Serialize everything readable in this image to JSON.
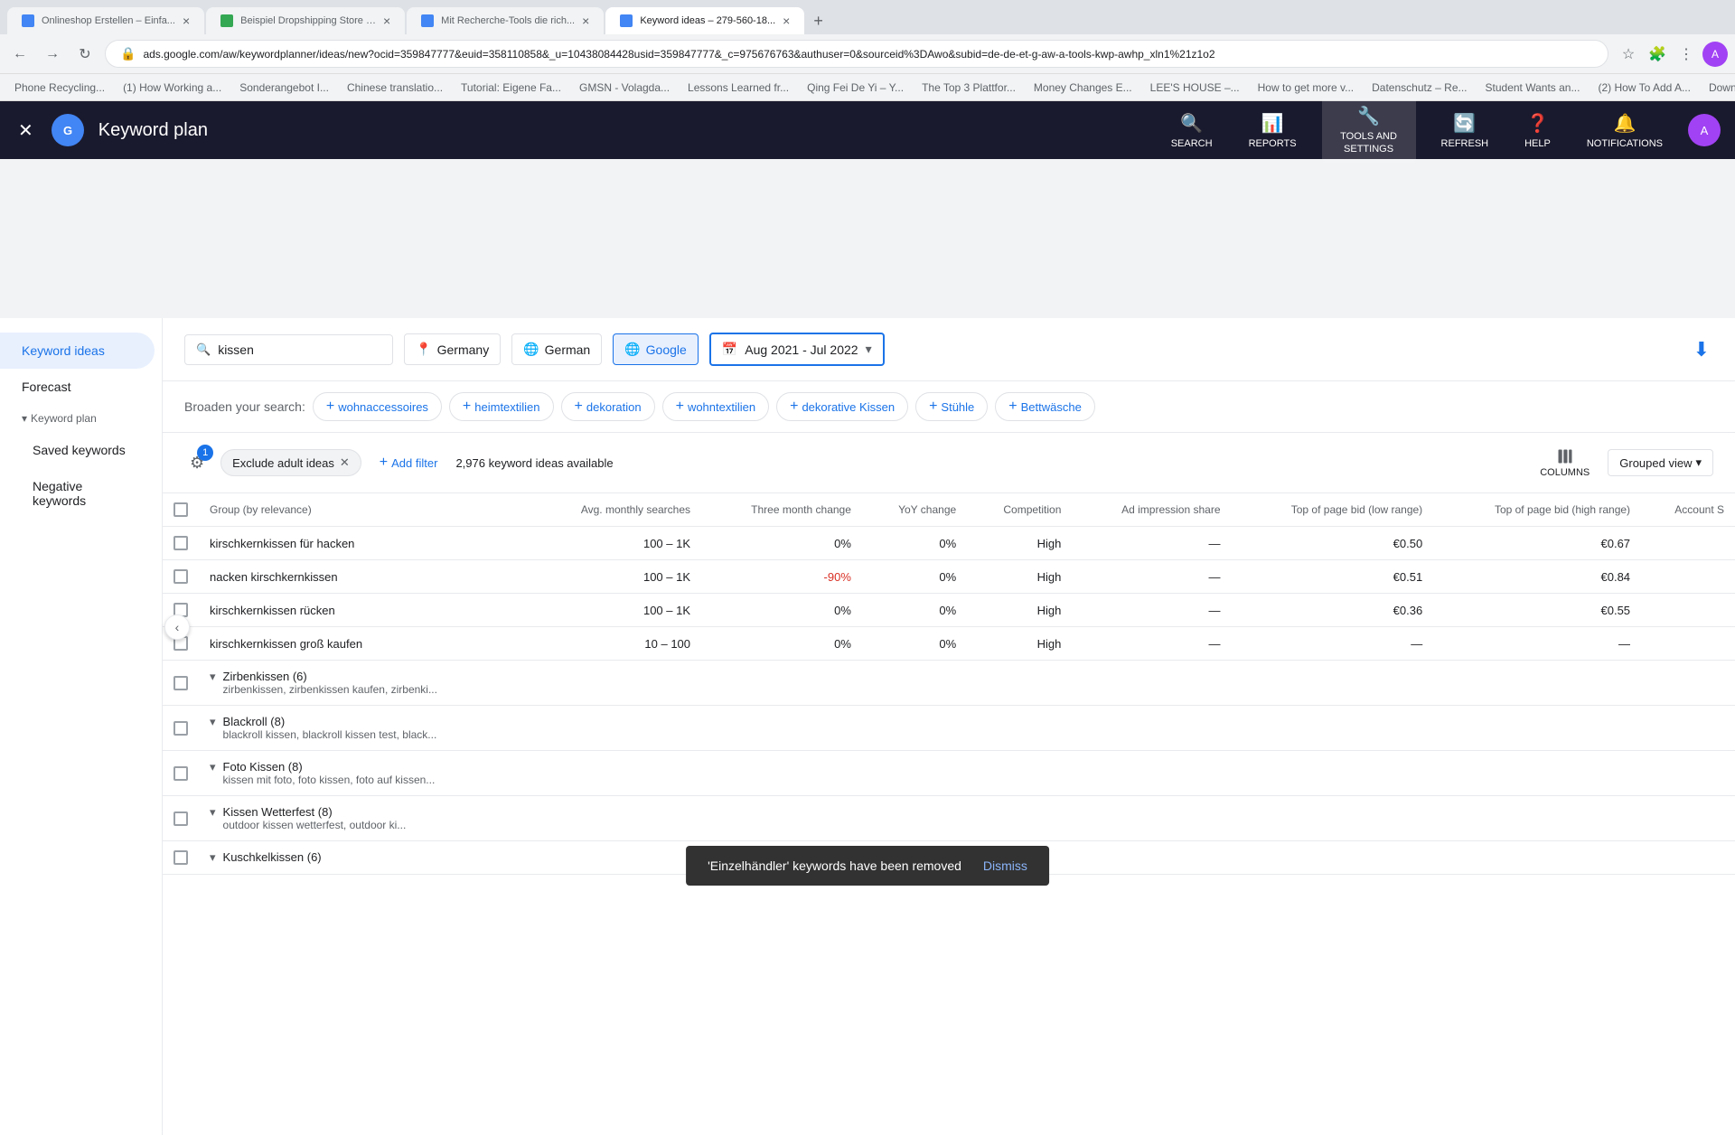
{
  "browser": {
    "tabs": [
      {
        "id": 1,
        "title": "Onlineshop Erstellen – Einfa...",
        "active": false,
        "favicon_color": "#4285f4"
      },
      {
        "id": 2,
        "title": "Beispiel Dropshipping Store –...",
        "active": false,
        "favicon_color": "#34a853"
      },
      {
        "id": 3,
        "title": "Mit Recherche-Tools die rich...",
        "active": false,
        "favicon_color": "#4285f4"
      },
      {
        "id": 4,
        "title": "Keyword ideas – 279-560-18...",
        "active": true,
        "favicon_color": "#4285f4"
      }
    ],
    "url": "ads.google.com/aw/keywordplanner/ideas/new?ocid=359847777&euid=358110858&_u=10438084428usid=359847777&_c=975676763&authuser=0&sourceid%3DAwo&subid=de-de-et-g-aw-a-tools-kwp-awhp_xln1%21z1o2",
    "bookmarks": [
      "Phone Recycling...",
      "(1) How Working a...",
      "Sonderangebot I...",
      "Chinese translatio...",
      "Tutorial: Eigene Fa...",
      "GMSN - Volagda...",
      "Lessons Learned fr...",
      "Qing Fei De Yi – Y...",
      "The Top 3 Plattfor...",
      "Money Changes E...",
      "LEE'S HOUSE –...",
      "How to get more v...",
      "Datenschutz – Re...",
      "Student Wants an...",
      "(2) How To Add A...",
      "Download – Cooki..."
    ]
  },
  "app": {
    "title": "Keyword plan",
    "nav": {
      "search_label": "SEARCH",
      "reports_label": "REPORTS",
      "tools_label": "TOOLS AND SETTINGS",
      "refresh_label": "REFRESH",
      "help_label": "HELP",
      "notifications_label": "NOTIFICATIONS"
    },
    "sidebar": {
      "items": [
        {
          "id": "keyword-ideas",
          "label": "Keyword ideas",
          "active": true
        },
        {
          "id": "forecast",
          "label": "Forecast",
          "active": false
        },
        {
          "id": "keyword-plan",
          "label": "Keyword plan",
          "active": false,
          "section": true
        },
        {
          "id": "saved-keywords",
          "label": "Saved keywords",
          "active": false
        },
        {
          "id": "negative-keywords",
          "label": "Negative keywords",
          "active": false
        }
      ]
    }
  },
  "filters": {
    "search_value": "kissen",
    "location": "Germany",
    "language": "German",
    "network": "Google",
    "date_range": "Aug 2021 - Jul 2022"
  },
  "broaden": {
    "label": "Broaden your search:",
    "chips": [
      "wohnaccessoires",
      "heimtextilien",
      "dekoration",
      "wohntextilien",
      "dekorative Kissen",
      "Stühle",
      "Bettwäsche"
    ]
  },
  "table_toolbar": {
    "filter_badge": "1",
    "exclude_chip": "Exclude adult ideas",
    "add_filter": "Add filter",
    "keyword_count": "2,976 keyword ideas available",
    "columns_label": "COLUMNS",
    "view_label": "Grouped view"
  },
  "table": {
    "headers": [
      {
        "id": "group",
        "label": "Group (by relevance)"
      },
      {
        "id": "avg-monthly",
        "label": "Avg. monthly searches"
      },
      {
        "id": "three-month",
        "label": "Three month change"
      },
      {
        "id": "yoy",
        "label": "YoY change"
      },
      {
        "id": "competition",
        "label": "Competition"
      },
      {
        "id": "ad-impression",
        "label": "Ad impression share"
      },
      {
        "id": "top-low",
        "label": "Top of page bid (low range)"
      },
      {
        "id": "top-high",
        "label": "Top of page bid (high range)"
      },
      {
        "id": "account",
        "label": "Account S"
      }
    ],
    "rows": [
      {
        "type": "keyword",
        "group": "kirschkernkissen für hacken",
        "avg": "100 – 1K",
        "three_month": "0%",
        "yoy": "0%",
        "competition": "High",
        "ad_impression": "—",
        "top_low": "€0.50",
        "top_high": "€0.67"
      },
      {
        "type": "keyword",
        "group": "nacken kirschkernkissen",
        "avg": "100 – 1K",
        "three_month": "-90%",
        "yoy": "0%",
        "competition": "High",
        "ad_impression": "—",
        "top_low": "€0.51",
        "top_high": "€0.84"
      },
      {
        "type": "keyword",
        "group": "kirschkernkissen rücken",
        "avg": "100 – 1K",
        "three_month": "0%",
        "yoy": "0%",
        "competition": "High",
        "ad_impression": "—",
        "top_low": "€0.36",
        "top_high": "€0.55"
      },
      {
        "type": "keyword",
        "group": "kirschkernkissen groß kaufen",
        "avg": "10 – 100",
        "three_month": "0%",
        "yoy": "0%",
        "competition": "High",
        "ad_impression": "—",
        "top_low": "—",
        "top_high": "—"
      },
      {
        "type": "group",
        "group": "Zirbenkissen (6)",
        "sub": "zirbenkissen, zirbenkissen kaufen, zirbenki...",
        "avg": "",
        "three_month": "",
        "yoy": "",
        "competition": "",
        "ad_impression": "",
        "top_low": "",
        "top_high": ""
      },
      {
        "type": "group",
        "group": "Blackroll (8)",
        "sub": "blackroll kissen, blackroll kissen test, black...",
        "avg": "",
        "three_month": "",
        "yoy": "",
        "competition": "",
        "ad_impression": "",
        "top_low": "",
        "top_high": ""
      },
      {
        "type": "group",
        "group": "Foto Kissen (8)",
        "sub": "kissen mit foto, foto kissen, foto auf kissen...",
        "avg": "",
        "three_month": "",
        "yoy": "",
        "competition": "",
        "ad_impression": "",
        "top_low": "",
        "top_high": ""
      },
      {
        "type": "group",
        "group": "Kissen Wetterfest (8)",
        "sub": "outdoor kissen wetterfest, outdoor ki...",
        "avg": "",
        "three_month": "",
        "yoy": "",
        "competition": "",
        "ad_impression": "",
        "top_low": "",
        "top_high": ""
      },
      {
        "type": "group",
        "group": "Kuschkelkissen (6)",
        "sub": "",
        "avg": "",
        "three_month": "",
        "yoy": "",
        "competition": "",
        "ad_impression": "",
        "top_low": "",
        "top_high": ""
      }
    ]
  },
  "snackbar": {
    "message": "'Einzelhändler' keywords have been removed",
    "dismiss": "Dismiss"
  }
}
